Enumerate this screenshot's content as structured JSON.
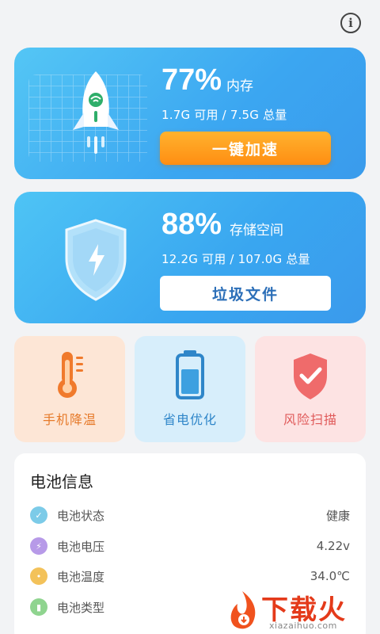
{
  "header": {
    "info_icon_glyph": "i"
  },
  "memory_card": {
    "percent": "77%",
    "label": "内存",
    "detail": "1.7G 可用 / 7.5G 总量",
    "button": "一键加速",
    "icon": "rocket-icon"
  },
  "storage_card": {
    "percent": "88%",
    "label": "存储空间",
    "detail": "12.2G 可用 / 107.0G 总量",
    "button": "垃圾文件",
    "icon": "shield-icon"
  },
  "tools": [
    {
      "label": "手机降温",
      "icon": "thermometer-icon",
      "color": "#f07a2c"
    },
    {
      "label": "省电优化",
      "icon": "battery-icon",
      "color": "#2f86c9"
    },
    {
      "label": "风险扫描",
      "icon": "shield-check-icon",
      "color": "#e05a5a"
    }
  ],
  "battery_info": {
    "title": "电池信息",
    "rows": [
      {
        "key": "电池状态",
        "value": "健康",
        "icon": "clipboard-check-icon",
        "color": "#7ccbe8"
      },
      {
        "key": "电池电压",
        "value": "4.22v",
        "icon": "lightning-icon",
        "color": "#b79ae8"
      },
      {
        "key": "电池温度",
        "value": "34.0℃",
        "icon": "thermometer-icon",
        "color": "#f3c25a"
      },
      {
        "key": "电池类型",
        "value": "",
        "icon": "battery-icon",
        "color": "#8fd48f"
      }
    ]
  },
  "watermark": {
    "brand": "下载火",
    "url": "xiazaihuo.com"
  }
}
